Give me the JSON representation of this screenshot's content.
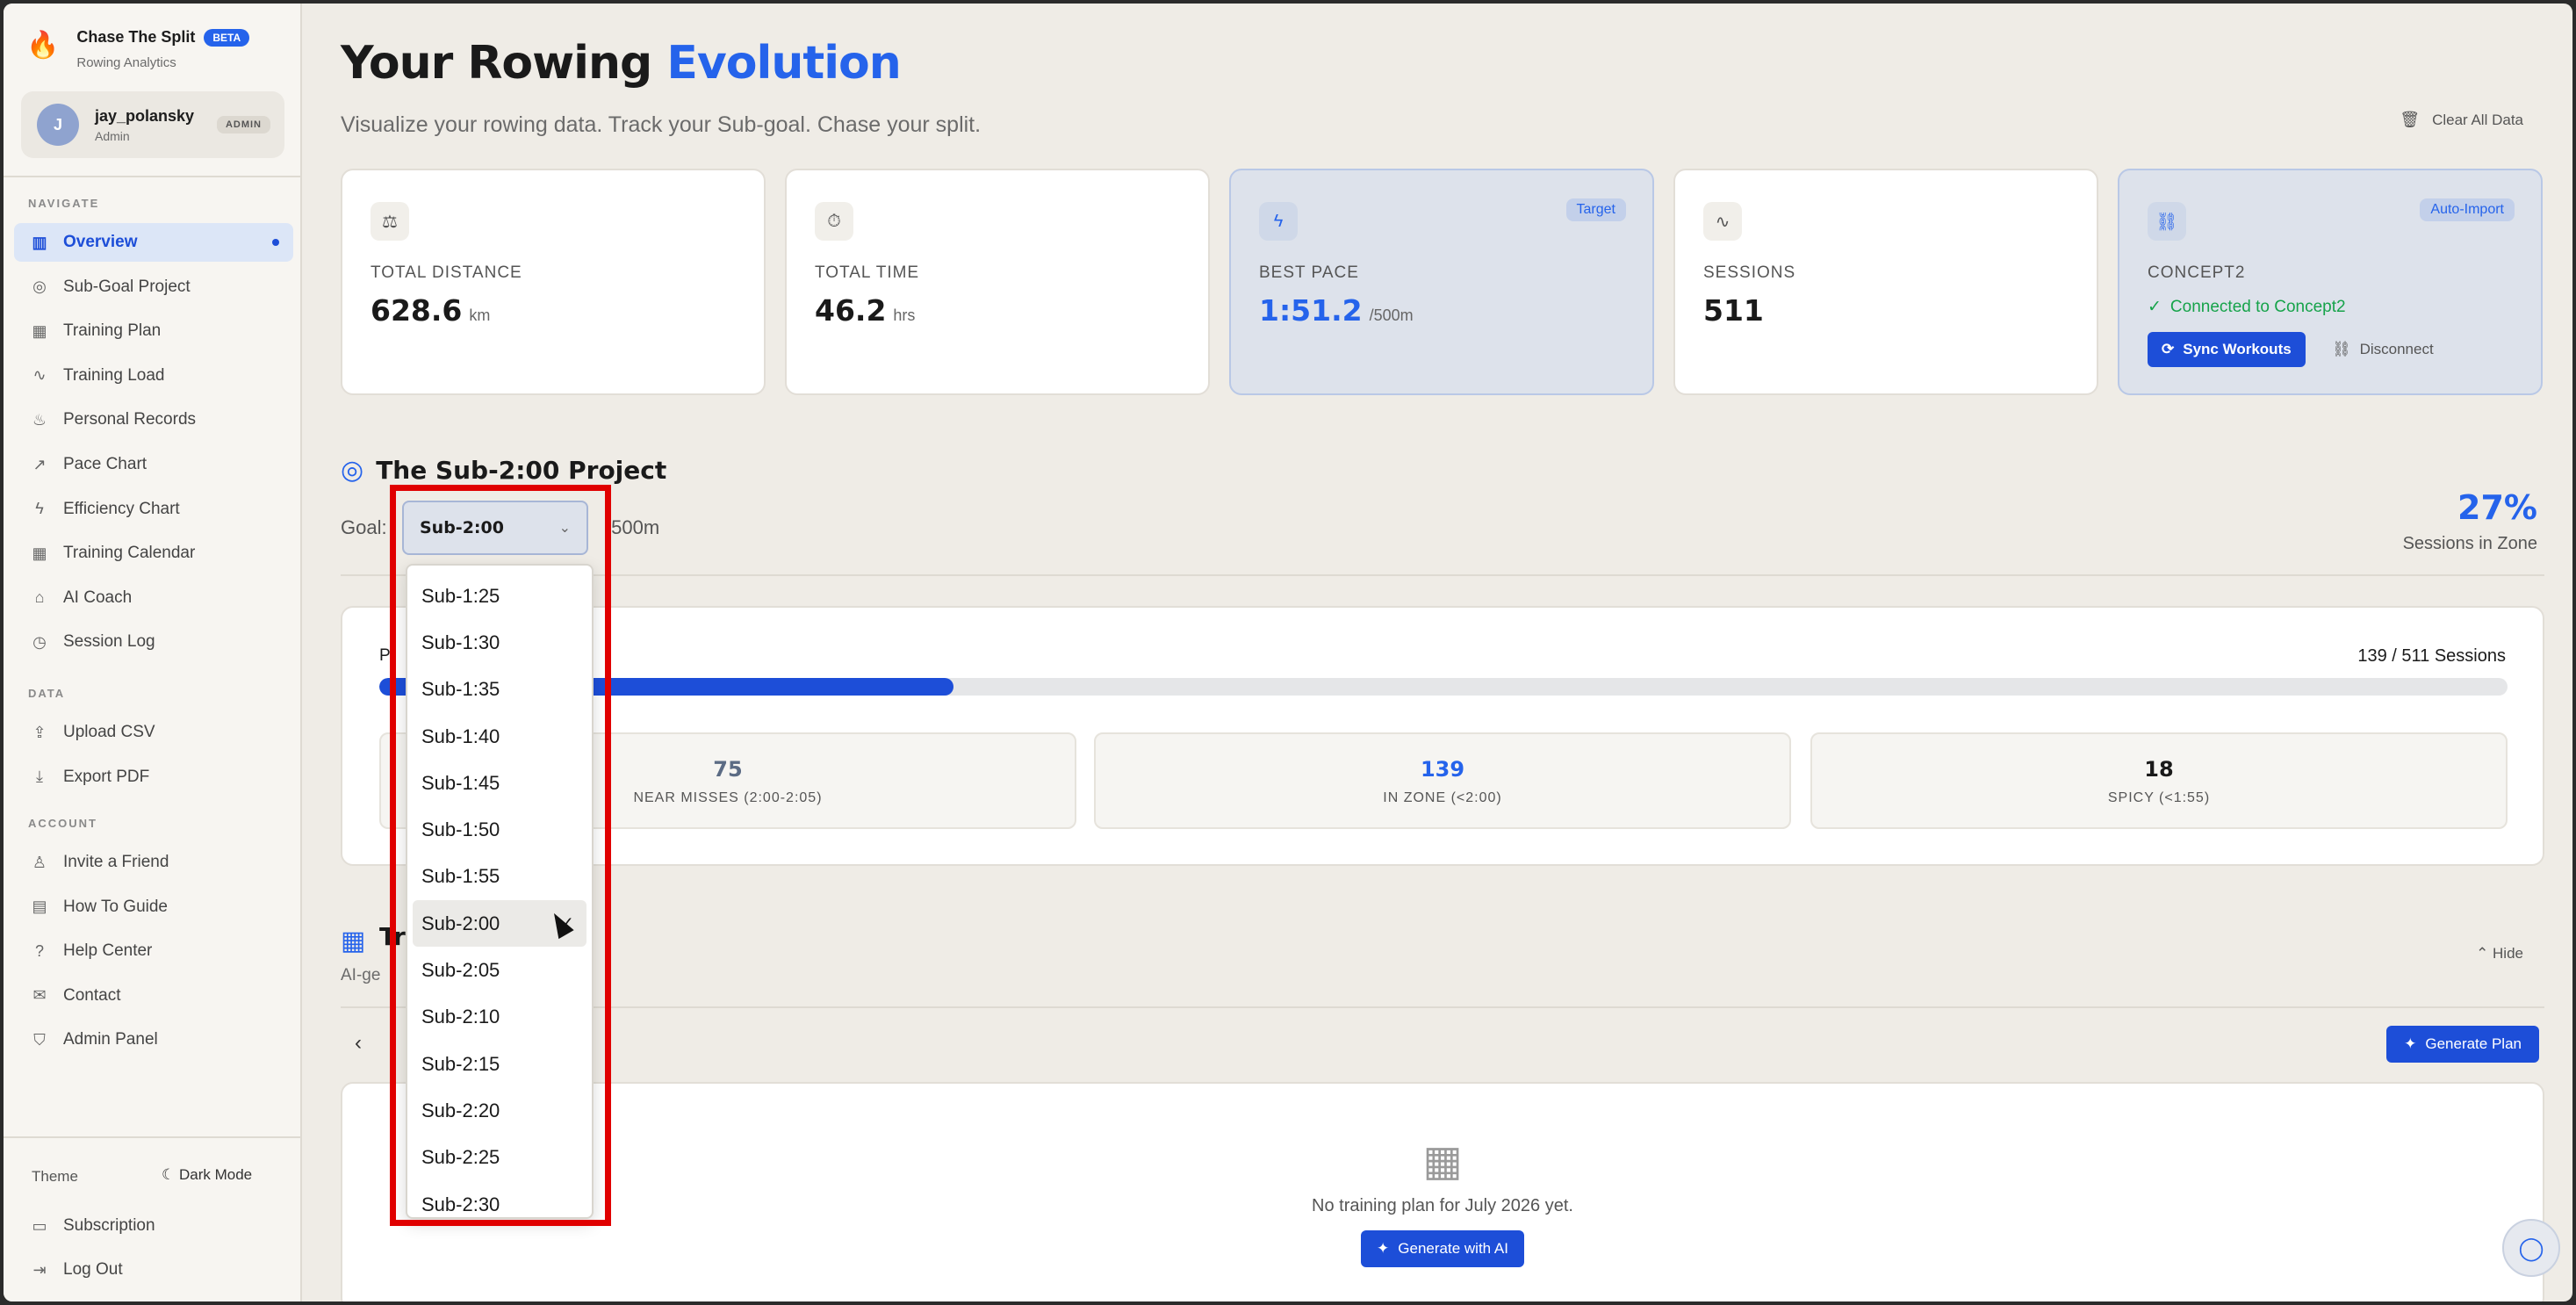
{
  "brand": {
    "name": "Chase The Split",
    "badge": "BETA",
    "tagline": "Rowing Analytics"
  },
  "user": {
    "initial": "J",
    "name": "jay_polansky",
    "role": "Admin",
    "badge": "ADMIN"
  },
  "sidebar": {
    "navigate_label": "NAVIGATE",
    "navigate": [
      {
        "label": "Overview",
        "icon": "bar-chart-icon",
        "glyph": "▥"
      },
      {
        "label": "Sub-Goal Project",
        "icon": "target-icon",
        "glyph": "◎"
      },
      {
        "label": "Training Plan",
        "icon": "calendar-icon",
        "glyph": "▦"
      },
      {
        "label": "Training Load",
        "icon": "activity-icon",
        "glyph": "∿"
      },
      {
        "label": "Personal Records",
        "icon": "flame-icon",
        "glyph": "♨"
      },
      {
        "label": "Pace Chart",
        "icon": "trend-icon",
        "glyph": "↗"
      },
      {
        "label": "Efficiency Chart",
        "icon": "bolt-icon",
        "glyph": "ϟ"
      },
      {
        "label": "Training Calendar",
        "icon": "calendar-icon",
        "glyph": "▦"
      },
      {
        "label": "AI Coach",
        "icon": "bot-icon",
        "glyph": "⌂"
      },
      {
        "label": "Session Log",
        "icon": "clock-icon",
        "glyph": "◷"
      }
    ],
    "data_label": "DATA",
    "data": [
      {
        "label": "Upload CSV",
        "icon": "upload-icon",
        "glyph": "⇪"
      },
      {
        "label": "Export PDF",
        "icon": "download-icon",
        "glyph": "⤓"
      }
    ],
    "account_label": "ACCOUNT",
    "account": [
      {
        "label": "Invite a Friend",
        "icon": "user-plus-icon",
        "glyph": "♙"
      },
      {
        "label": "How To Guide",
        "icon": "book-icon",
        "glyph": "▤"
      },
      {
        "label": "Help Center",
        "icon": "help-icon",
        "glyph": "?"
      },
      {
        "label": "Contact",
        "icon": "mail-icon",
        "glyph": "✉"
      },
      {
        "label": "Admin Panel",
        "icon": "shield-icon",
        "glyph": "⛉"
      }
    ],
    "theme_label": "Theme",
    "theme_toggle": "Dark Mode",
    "subscription": "Subscription",
    "logout": "Log Out"
  },
  "header": {
    "title_main": "Your Rowing ",
    "title_accent": "Evolution",
    "subtitle": "Visualize your rowing data. Track your Sub-goal. Chase your split.",
    "clear_all": "Clear All Data"
  },
  "stats": {
    "distance": {
      "label": "TOTAL DISTANCE",
      "value": "628.6",
      "unit": "km"
    },
    "time": {
      "label": "TOTAL TIME",
      "value": "46.2",
      "unit": "hrs"
    },
    "pace": {
      "label": "BEST PACE",
      "value": "1:51.2",
      "unit": "/500m",
      "tag": "Target"
    },
    "sessions": {
      "label": "SESSIONS",
      "value": "511"
    },
    "concept2": {
      "label": "CONCEPT2",
      "tag": "Auto-Import",
      "status": "Connected to Concept2",
      "sync": "Sync Workouts",
      "disconnect": "Disconnect"
    }
  },
  "project": {
    "title": "The Sub-2:00 Project",
    "goal_label": "Goal:",
    "goal_value": "Sub-2:00",
    "goal_tail": "/500m",
    "percent": "27%",
    "percent_label": "Sessions in Zone",
    "progress_count": "139 / 511 Sessions",
    "progress_fraction": 0.27,
    "buckets": [
      {
        "value": "75",
        "label": "NEAR MISSES (2:00-2:05)"
      },
      {
        "value": "139",
        "label": "IN ZONE (<2:00)"
      },
      {
        "value": "18",
        "label": "SPICY (<1:55)"
      }
    ]
  },
  "goal_dropdown": {
    "options": [
      "Sub-1:25",
      "Sub-1:30",
      "Sub-1:35",
      "Sub-1:40",
      "Sub-1:45",
      "Sub-1:50",
      "Sub-1:55",
      "Sub-2:00",
      "Sub-2:05",
      "Sub-2:10",
      "Sub-2:15",
      "Sub-2:20",
      "Sub-2:25",
      "Sub-2:30"
    ],
    "selected": "Sub-2:00"
  },
  "training_plan": {
    "hide": "Hide",
    "generate_plan": "Generate Plan",
    "empty_message": "No training plan for July 2026 yet.",
    "generate_ai": "Generate with AI"
  },
  "colors": {
    "accent": "#2563eb",
    "success": "#16a34a",
    "highlight": "#e00000"
  }
}
